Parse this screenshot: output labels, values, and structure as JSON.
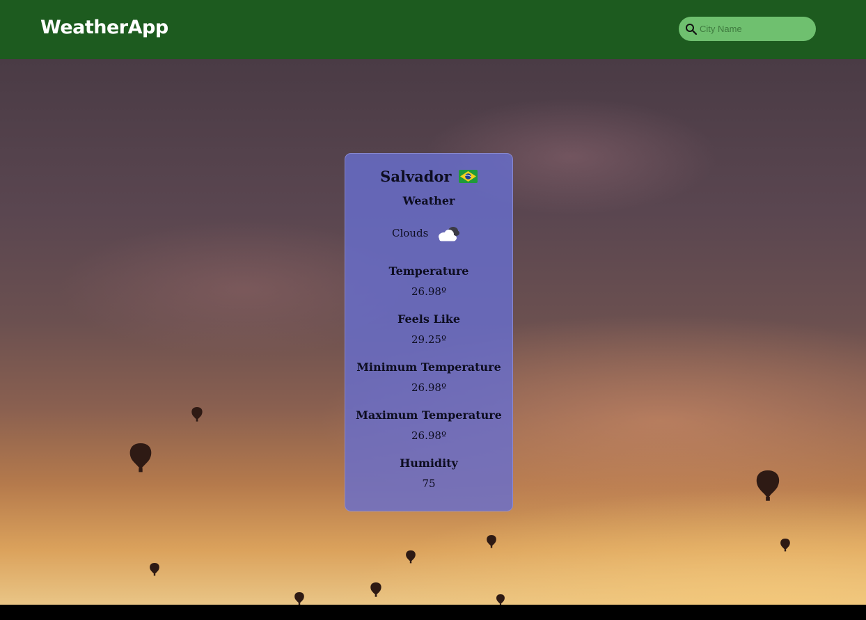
{
  "header": {
    "logo": "WeatherApp",
    "search": {
      "placeholder": "City Name",
      "value": ""
    }
  },
  "card": {
    "city": "Salvador",
    "country_flag_icon": "brazil-flag-icon",
    "weather_label": "Weather",
    "condition": "Clouds",
    "condition_icon": "cloudy-icon",
    "temperature_label": "Temperature",
    "temperature": "26.98º",
    "feels_like_label": "Feels Like",
    "feels_like": "29.25º",
    "min_temp_label": "Minimum Temperature",
    "min_temp": "26.98º",
    "max_temp_label": "Maximum Temperature",
    "max_temp": "26.98º",
    "humidity_label": "Humidity",
    "humidity": "75"
  },
  "colors": {
    "header_bg": "#1d5b1f",
    "search_bg": "#6fc06f",
    "card_bg": "#686ecd"
  }
}
